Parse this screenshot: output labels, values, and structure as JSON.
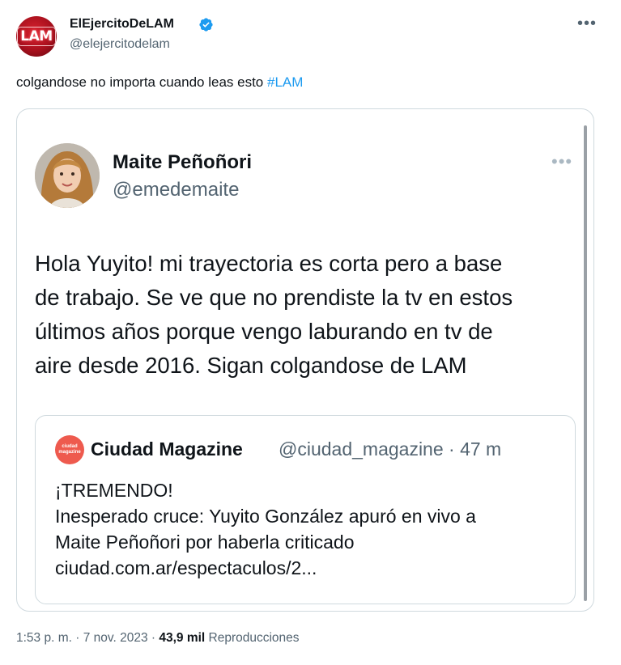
{
  "tweet": {
    "author_name": "ElEjercitoDeLAM",
    "author_handle": "@elejercitodelam",
    "avatar_text": "LAM",
    "more_icon": "more-horizontal-icon",
    "text": "colgandose no importa cuando leas esto",
    "hashtag": "#LAM"
  },
  "embedded_tweet": {
    "author_name": "Maite Peñoñori",
    "author_handle": "@emedemaite",
    "text_lines": [
      "Hola Yuyito! mi trayectoria es corta pero a base",
      "de trabajo. Se ve que no prendiste la tv en estos",
      "últimos años porque vengo laburando en tv de",
      "aire desde 2016. Sigan colgandose de LAM"
    ]
  },
  "quoted_tweet": {
    "avatar_text_top": "ciudad",
    "avatar_text_bottom": "magazine",
    "author_name": "Ciudad Magazine",
    "meta": "@ciudad_magazine · 47 m",
    "text_lines": [
      "¡TREMENDO!",
      "Inesperado cruce: Yuyito González apuró en vivo a",
      "Maite Peñoñori por haberla criticado",
      "ciudad.com.ar/espectaculos/2..."
    ]
  },
  "footer": {
    "time_date": "1:53 p. m. · 7 nov. 2023 · ",
    "views_count": "43,9 mil",
    "views_label": "Reproducciones"
  },
  "colors": {
    "accent": "#1d9bf0",
    "secondary_text": "#536471",
    "border": "#cfd9de"
  }
}
